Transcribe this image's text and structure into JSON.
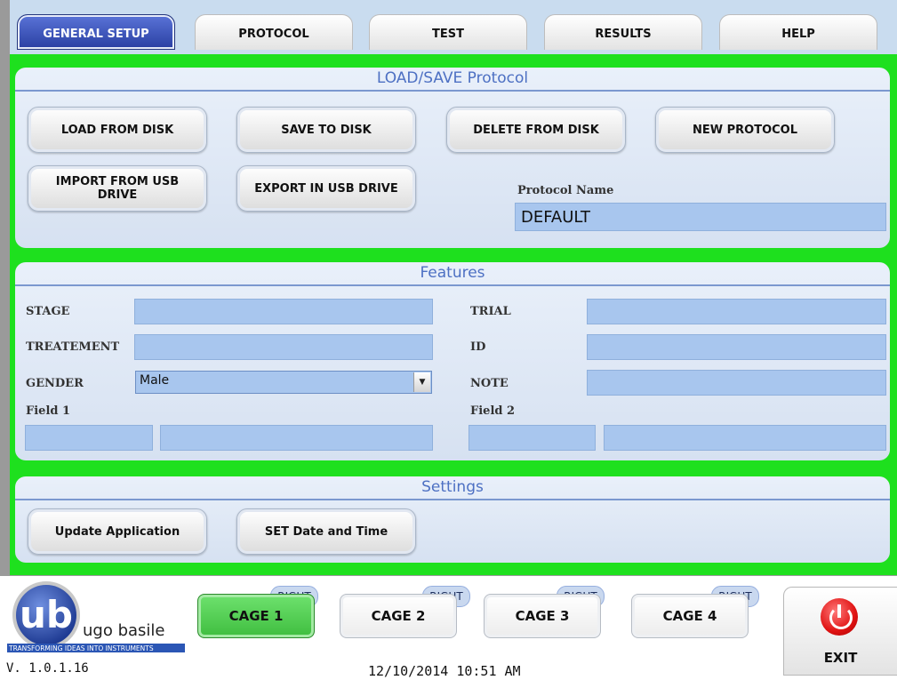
{
  "tabs": [
    {
      "label": "GENERAL SETUP",
      "active": true
    },
    {
      "label": "PROTOCOL",
      "active": false
    },
    {
      "label": "TEST",
      "active": false
    },
    {
      "label": "RESULTS",
      "active": false
    },
    {
      "label": "HELP",
      "active": false
    }
  ],
  "load_save": {
    "title": "LOAD/SAVE Protocol",
    "load_label": "LOAD FROM DISK",
    "save_label": "SAVE TO DISK",
    "delete_label": "DELETE FROM DISK",
    "new_label": "NEW PROTOCOL",
    "import_label": "IMPORT FROM USB DRIVE",
    "export_label": "EXPORT IN USB DRIVE",
    "protocol_name_label": "Protocol Name",
    "protocol_name_value": "DEFAULT"
  },
  "features": {
    "title": "Features",
    "stage_label": "STAGE",
    "stage_value": "",
    "treatement_label": "TREATEMENT",
    "treatement_value": "",
    "gender_label": "GENDER",
    "gender_value": "Male",
    "field1_label": "Field 1",
    "trial_label": "TRIAL",
    "trial_value": "",
    "id_label": "ID",
    "id_value": "",
    "note_label": "NOTE",
    "note_value": "",
    "field2_label": "Field 2"
  },
  "settings": {
    "title": "Settings",
    "update_label": "Update Application",
    "datetime_label": "SET Date and Time"
  },
  "cages": [
    {
      "label": "CAGE 1",
      "side": "RIGHT",
      "active": true
    },
    {
      "label": "CAGE 2",
      "side": "RIGHT",
      "active": false
    },
    {
      "label": "CAGE 3",
      "side": "RIGHT",
      "active": false
    },
    {
      "label": "CAGE 4",
      "side": "RIGHT",
      "active": false
    }
  ],
  "exit_label": "EXIT",
  "brand": {
    "name": "ugo basile",
    "tagline": "TRANSFORMING IDEAS INTO INSTRUMENTS"
  },
  "version": "V. 1.0.1.16",
  "datetime": "12/10/2014 10:51 AM",
  "colors": {
    "background_green": "#1ee01e",
    "tab_active": "#2a3fa2",
    "field_blue": "#a8c6ee",
    "panel_title": "#4d70c3"
  }
}
